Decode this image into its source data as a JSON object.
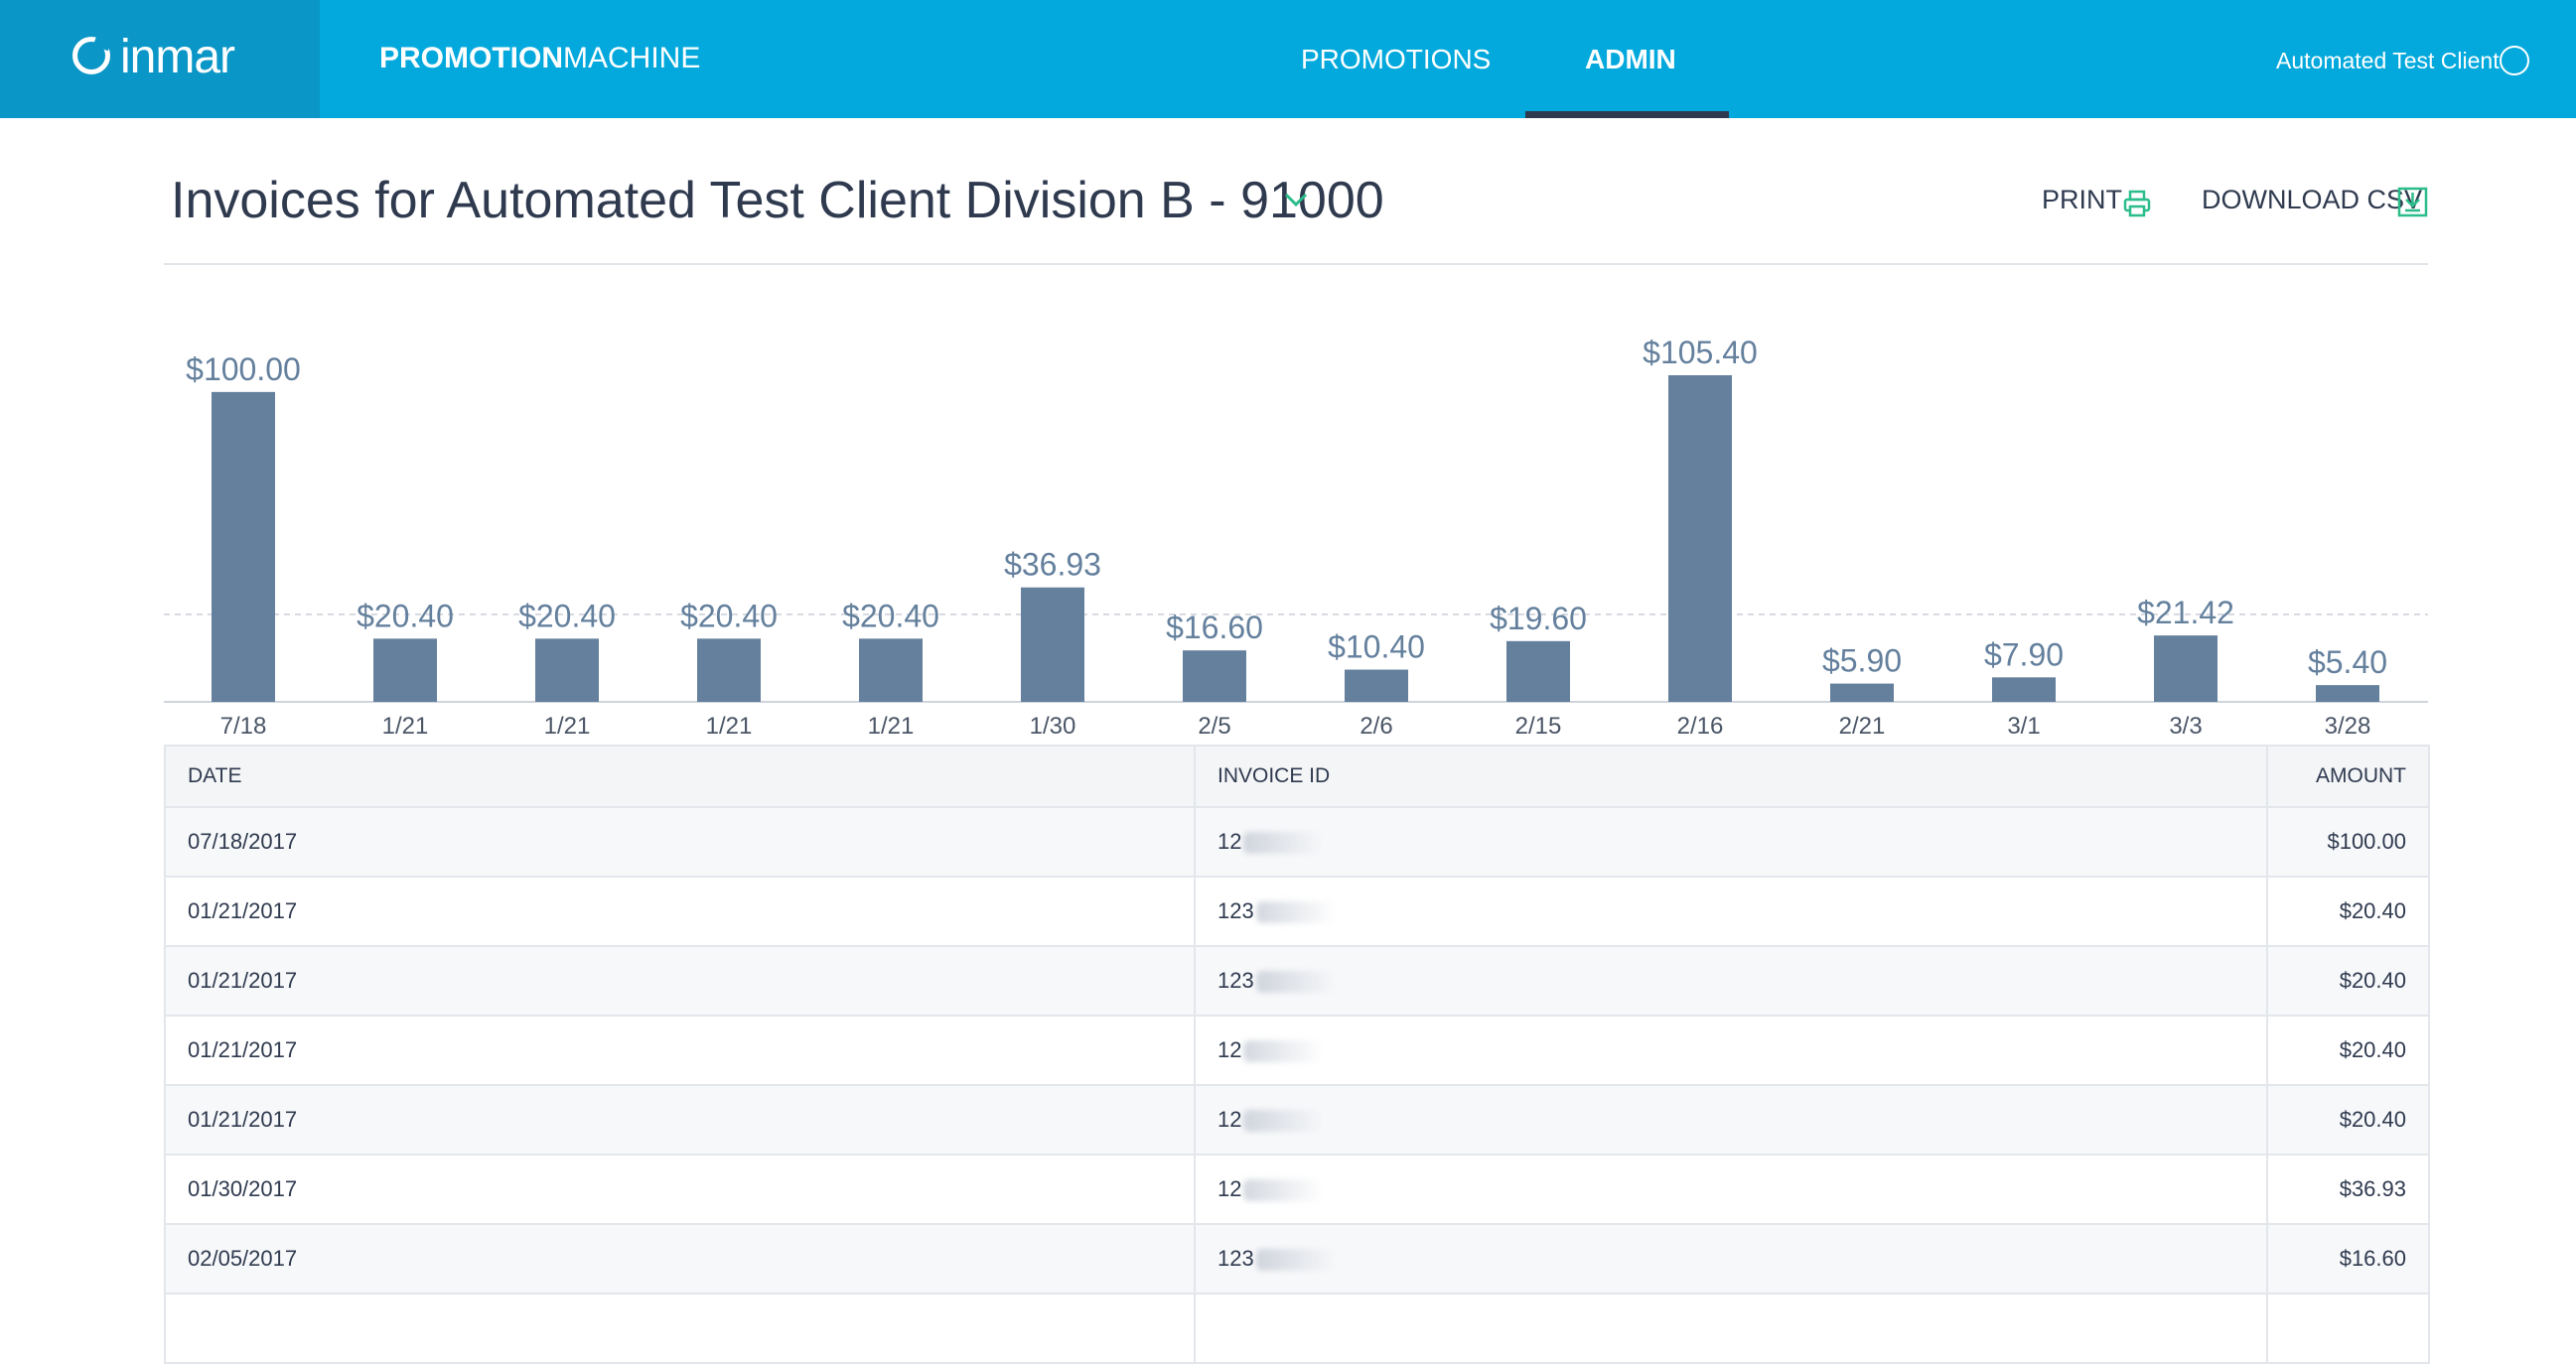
{
  "brand": {
    "logo_text": "inmar",
    "product_name_bold": "PROMOTION",
    "product_name_light": "MACHINE"
  },
  "nav": {
    "tabs": [
      {
        "label": "PROMOTIONS",
        "active": false
      },
      {
        "label": "ADMIN",
        "active": true
      }
    ]
  },
  "user": {
    "client_name": "Automated Test Client"
  },
  "page": {
    "title": "Invoices for Automated Test Client Division B - 91000",
    "print_label": "PRINT",
    "download_label": "DOWNLOAD CSV"
  },
  "colors": {
    "topbar": "#03a9dd",
    "brand_box": "#0a96c6",
    "accent_green": "#2bbd8a",
    "bar": "#64809d",
    "active_tab_underline": "#2f3a4f"
  },
  "icons": {
    "dropdown": "chevron-down-icon",
    "print": "printer-icon",
    "download": "download-icon",
    "avatar": "user-avatar-icon"
  },
  "chart_data": {
    "type": "bar",
    "categories": [
      "7/18",
      "1/21",
      "1/21",
      "1/21",
      "1/21",
      "1/30",
      "2/5",
      "2/6",
      "2/15",
      "2/16",
      "2/21",
      "3/1",
      "3/3",
      "3/28"
    ],
    "values": [
      100.0,
      20.4,
      20.4,
      20.4,
      20.4,
      36.93,
      16.6,
      10.4,
      19.6,
      105.4,
      5.9,
      7.9,
      21.42,
      5.4
    ],
    "value_labels": [
      "$100.00",
      "$20.40",
      "$20.40",
      "$20.40",
      "$20.40",
      "$36.93",
      "$16.60",
      "$10.40",
      "$19.60",
      "$105.40",
      "$5.90",
      "$7.90",
      "$21.42",
      "$5.40"
    ],
    "reference_line": 28.25,
    "grid": false
  },
  "table": {
    "headers": {
      "date": "DATE",
      "invoice_id": "INVOICE ID",
      "amount": "AMOUNT"
    },
    "rows": [
      {
        "date": "07/18/2017",
        "invoice_id": "12",
        "amount": "$100.00"
      },
      {
        "date": "01/21/2017",
        "invoice_id": "123",
        "amount": "$20.40"
      },
      {
        "date": "01/21/2017",
        "invoice_id": "123",
        "amount": "$20.40"
      },
      {
        "date": "01/21/2017",
        "invoice_id": "12",
        "amount": "$20.40"
      },
      {
        "date": "01/21/2017",
        "invoice_id": "12",
        "amount": "$20.40"
      },
      {
        "date": "01/30/2017",
        "invoice_id": "12",
        "amount": "$36.93"
      },
      {
        "date": "02/05/2017",
        "invoice_id": "123",
        "amount": "$16.60"
      }
    ]
  }
}
